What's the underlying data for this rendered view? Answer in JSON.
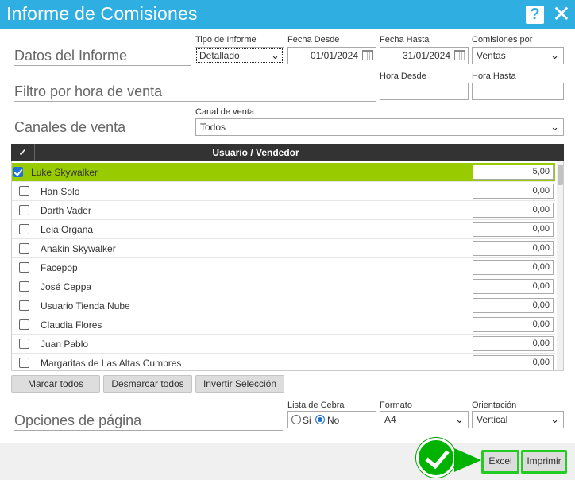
{
  "window": {
    "title": "Informe de Comisiones",
    "help_label": "?",
    "close_label": "✕"
  },
  "sections": {
    "datos": "Datos del Informe",
    "filtro": "Filtro por hora de venta",
    "canales": "Canales de venta",
    "opciones": "Opciones de página"
  },
  "fields": {
    "tipo": {
      "label": "Tipo de Informe",
      "value": "Detallado"
    },
    "fecha_desde": {
      "label": "Fecha Desde",
      "value": "01/01/2024"
    },
    "fecha_hasta": {
      "label": "Fecha Hasta",
      "value": "31/01/2024"
    },
    "comisiones": {
      "label": "Comisiones por",
      "value": "Ventas"
    },
    "hora_desde": {
      "label": "Hora Desde",
      "value": ""
    },
    "hora_hasta": {
      "label": "Hora Hasta",
      "value": ""
    },
    "canal": {
      "label": "Canal de venta",
      "value": "Todos"
    }
  },
  "grid": {
    "header_check": "✓",
    "header_user": "Usuario / Vendedor",
    "rows": [
      {
        "name": "Luke Skywalker",
        "value": "5,00",
        "checked": true
      },
      {
        "name": "Han Solo",
        "value": "0,00",
        "checked": false
      },
      {
        "name": "Darth Vader",
        "value": "0,00",
        "checked": false
      },
      {
        "name": "Leia Organa",
        "value": "0,00",
        "checked": false
      },
      {
        "name": "Anakin Skywalker",
        "value": "0,00",
        "checked": false
      },
      {
        "name": "Facepop",
        "value": "0,00",
        "checked": false
      },
      {
        "name": "José Ceppa",
        "value": "0,00",
        "checked": false
      },
      {
        "name": "Usuario Tienda Nube",
        "value": "0,00",
        "checked": false
      },
      {
        "name": "Claudia Flores",
        "value": "0,00",
        "checked": false
      },
      {
        "name": "Juan Pablo",
        "value": "0,00",
        "checked": false
      },
      {
        "name": "Margaritas de Las Altas Cumbres",
        "value": "0,00",
        "checked": false
      }
    ]
  },
  "actions": {
    "marcar": "Marcar todos",
    "desmarcar": "Desmarcar todos",
    "invertir": "Invertir Selección"
  },
  "page_options": {
    "cebra": {
      "label": "Lista de Cebra",
      "si": "Si",
      "no": "No",
      "selected": "No"
    },
    "formato": {
      "label": "Formato",
      "value": "A4"
    },
    "orientacion": {
      "label": "Orientación",
      "value": "Vertical"
    }
  },
  "footer": {
    "excel": "Excel",
    "imprimir": "Imprimir"
  },
  "colors": {
    "titlebar": "#2eaee1",
    "selected_row": "#99cc00",
    "highlight": "#22cc22",
    "header": "#333333"
  }
}
